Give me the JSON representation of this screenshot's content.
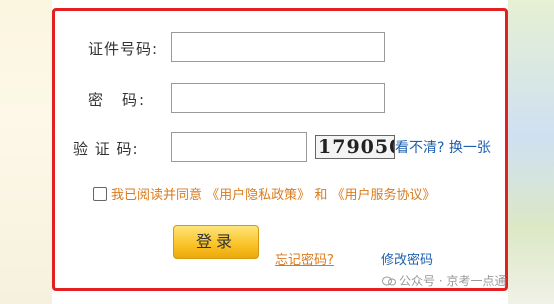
{
  "form": {
    "id_label": "证件号码:",
    "password_label": "密　码:",
    "captcha_label": "验 证 码:",
    "id_value": "",
    "password_value": "",
    "captcha_value": "",
    "captcha_image_text": "179050",
    "refresh_text": "看不清? 换一张"
  },
  "agreement": {
    "prefix": "我已阅读并同意",
    "privacy_link": "《用户隐私政策》",
    "and": "和",
    "service_link": "《用户服务协议》"
  },
  "actions": {
    "login_label": "登录",
    "forgot_label": "忘记密码?",
    "modify_label": "修改密码"
  },
  "watermark": {
    "text": "公众号 · 京考一点通"
  },
  "colors": {
    "border": "#e32020",
    "link_orange": "#d97a1c",
    "link_blue": "#1f5fae",
    "button": "#fbc52b"
  }
}
